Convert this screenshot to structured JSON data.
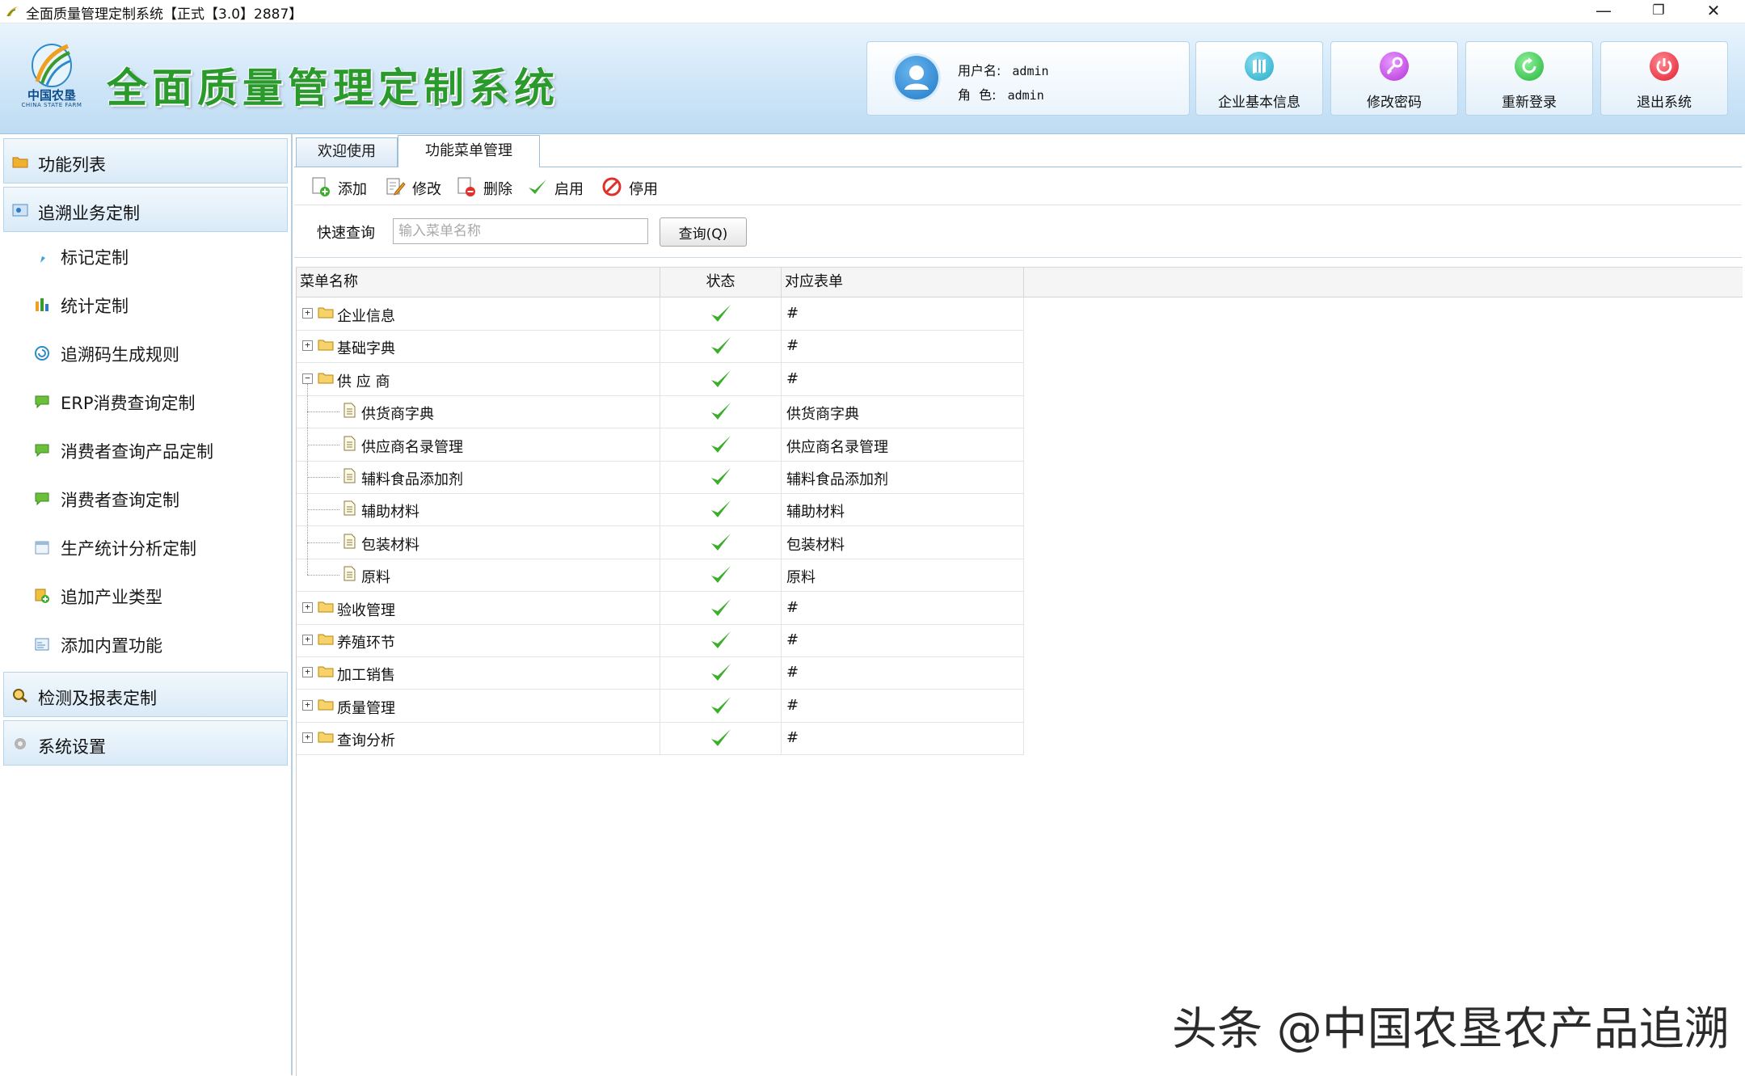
{
  "window": {
    "title": "全面质量管理定制系统【正式【3.0】2887】",
    "min_glyph": "—",
    "max_glyph": "❐",
    "close_glyph": "✕"
  },
  "header": {
    "logo_text": "中国农垦",
    "logo_subtext": "CHINA STATE FARM",
    "app_title": "全面质量管理定制系统",
    "username_label": "用户名:",
    "username": "admin",
    "role_label": "角  色:",
    "role": "admin",
    "buttons": [
      {
        "label": "企业基本信息",
        "icon": "map-icon"
      },
      {
        "label": "修改密码",
        "icon": "key-icon"
      },
      {
        "label": "重新登录",
        "icon": "refresh-icon"
      },
      {
        "label": "退出系统",
        "icon": "power-icon"
      }
    ]
  },
  "sidebar": {
    "groups": [
      {
        "label": "功能列表",
        "icon": "folder-icon"
      },
      {
        "label": "追溯业务定制",
        "icon": "settings-icon"
      },
      {
        "label": "检测及报表定制",
        "icon": "magnifier-icon"
      },
      {
        "label": "系统设置",
        "icon": "gear-icon"
      }
    ],
    "items": [
      {
        "label": "标记定制",
        "icon": "marker-icon"
      },
      {
        "label": "统计定制",
        "icon": "bar-chart-icon"
      },
      {
        "label": "追溯码生成规则",
        "icon": "spiral-icon"
      },
      {
        "label": "ERP消费查询定制",
        "icon": "message-icon"
      },
      {
        "label": "消费者查询产品定制",
        "icon": "message-icon"
      },
      {
        "label": "消费者查询定制",
        "icon": "message-icon"
      },
      {
        "label": "生产统计分析定制",
        "icon": "calendar-icon"
      },
      {
        "label": "追加产业类型",
        "icon": "add-icon"
      },
      {
        "label": "添加内置功能",
        "icon": "window-icon"
      }
    ]
  },
  "tabs": [
    {
      "label": "欢迎使用",
      "active": false
    },
    {
      "label": "功能菜单管理",
      "active": true
    }
  ],
  "toolbar": {
    "add": "添加",
    "edit": "修改",
    "delete": "删除",
    "enable": "启用",
    "disable": "停用"
  },
  "search": {
    "label": "快速查询",
    "placeholder": "输入菜单名称",
    "button": "查询(Q)"
  },
  "grid": {
    "columns": [
      "菜单名称",
      "状态",
      "对应表单"
    ],
    "rows": [
      {
        "name": "企业信息",
        "type": "folder",
        "expanded": false,
        "form": "#"
      },
      {
        "name": "基础字典",
        "type": "folder",
        "expanded": false,
        "form": "#"
      },
      {
        "name": "供  应  商",
        "type": "folder",
        "expanded": true,
        "form": "#"
      },
      {
        "name": "供货商字典",
        "type": "doc",
        "form": "供货商字典"
      },
      {
        "name": "供应商名录管理",
        "type": "doc",
        "form": "供应商名录管理"
      },
      {
        "name": "辅料食品添加剂",
        "type": "doc",
        "form": "辅料食品添加剂"
      },
      {
        "name": "辅助材料",
        "type": "doc",
        "form": "辅助材料"
      },
      {
        "name": "包装材料",
        "type": "doc",
        "form": "包装材料"
      },
      {
        "name": "原料",
        "type": "doc",
        "form": "原料"
      },
      {
        "name": "验收管理",
        "type": "folder",
        "expanded": false,
        "form": "#"
      },
      {
        "name": "养殖环节",
        "type": "folder",
        "expanded": false,
        "form": "#"
      },
      {
        "name": "加工销售",
        "type": "folder",
        "expanded": false,
        "form": "#"
      },
      {
        "name": "质量管理",
        "type": "folder",
        "expanded": false,
        "form": "#"
      },
      {
        "name": "查询分析",
        "type": "folder",
        "expanded": false,
        "form": "#"
      }
    ],
    "status_icon": "check-icon",
    "expand_glyph": "+",
    "collapse_glyph": "−"
  },
  "watermark": "头条 @中国农垦农产品追溯",
  "colors": {
    "title_green": "#2a9a2c",
    "header_blue": "#cfe6f8",
    "check_green": "#3cae2c"
  }
}
